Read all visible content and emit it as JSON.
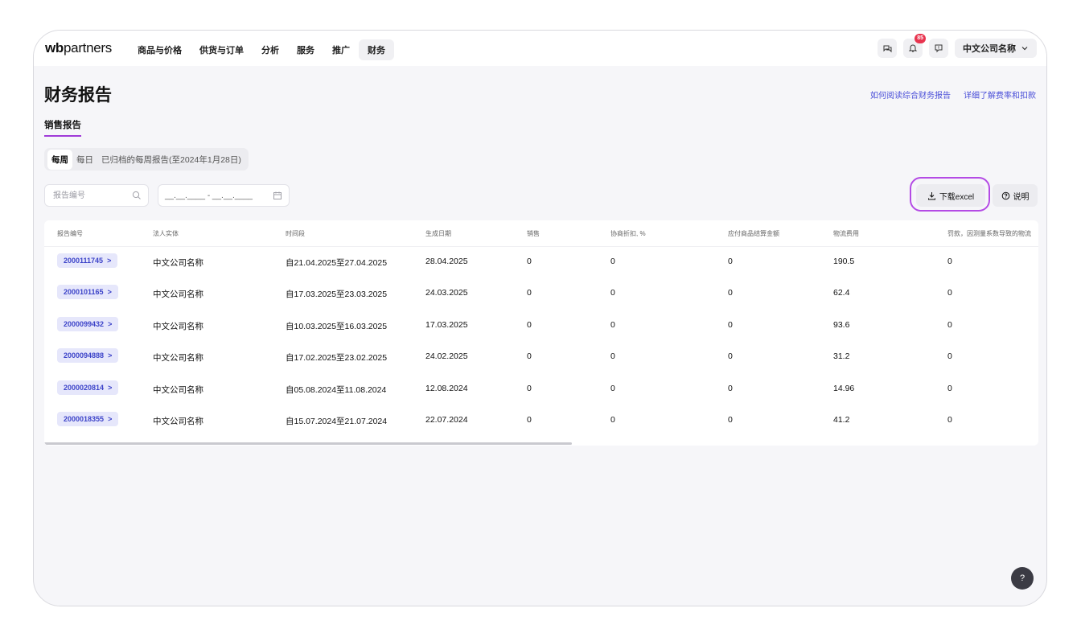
{
  "logo": {
    "bold": "wb",
    "rest": "partners"
  },
  "nav": [
    {
      "label": "商品与价格"
    },
    {
      "label": "供货与订单"
    },
    {
      "label": "分析"
    },
    {
      "label": "服务"
    },
    {
      "label": "推广"
    },
    {
      "label": "财务"
    }
  ],
  "header": {
    "notifications_badge": "85",
    "company_label": "中文公司名称"
  },
  "page": {
    "title": "财务报告",
    "help_link_1": "如何阅读综合财务报告",
    "help_link_2": "详细了解费率和扣款",
    "subtab": "销售报告"
  },
  "segments": [
    {
      "label": "每周",
      "active": true
    },
    {
      "label": "每日",
      "active": false
    },
    {
      "label": "已归档的每周报告(至2024年1月28日)",
      "active": false
    }
  ],
  "filters": {
    "search_placeholder": "报告编号",
    "date_placeholder": "__.__.____ - __.__.____"
  },
  "actions": {
    "download_label": "下载excel",
    "info_label": "说明"
  },
  "table": {
    "columns": [
      "报告编号",
      "法人实体",
      "时间段",
      "生成日期",
      "销售",
      "协商折扣, %",
      "应付商品结算金额",
      "物流费用",
      "罚款，因测量系数导致的物流"
    ],
    "rows": [
      {
        "id": "2000111745",
        "entity": "中文公司名称",
        "period": "自21.04.2025至27.04.2025",
        "created": "28.04.2025",
        "sales": "0",
        "discount": "0",
        "payable": "0",
        "logistics": "190.5",
        "fines": "0"
      },
      {
        "id": "2000101165",
        "entity": "中文公司名称",
        "period": "自17.03.2025至23.03.2025",
        "created": "24.03.2025",
        "sales": "0",
        "discount": "0",
        "payable": "0",
        "logistics": "62.4",
        "fines": "0"
      },
      {
        "id": "2000099432",
        "entity": "中文公司名称",
        "period": "自10.03.2025至16.03.2025",
        "created": "17.03.2025",
        "sales": "0",
        "discount": "0",
        "payable": "0",
        "logistics": "93.6",
        "fines": "0"
      },
      {
        "id": "2000094888",
        "entity": "中文公司名称",
        "period": "自17.02.2025至23.02.2025",
        "created": "24.02.2025",
        "sales": "0",
        "discount": "0",
        "payable": "0",
        "logistics": "31.2",
        "fines": "0"
      },
      {
        "id": "2000020814",
        "entity": "中文公司名称",
        "period": "自05.08.2024至11.08.2024",
        "created": "12.08.2024",
        "sales": "0",
        "discount": "0",
        "payable": "0",
        "logistics": "14.96",
        "fines": "0"
      },
      {
        "id": "2000018355",
        "entity": "中文公司名称",
        "period": "自15.07.2024至21.07.2024",
        "created": "22.07.2024",
        "sales": "0",
        "discount": "0",
        "payable": "0",
        "logistics": "41.2",
        "fines": "0"
      }
    ]
  },
  "help_button": "?",
  "colors": {
    "accent": "#4a4fd8",
    "highlight": "#b44be5",
    "chip_bg": "#e6e7fb",
    "badge": "#e8344f"
  }
}
